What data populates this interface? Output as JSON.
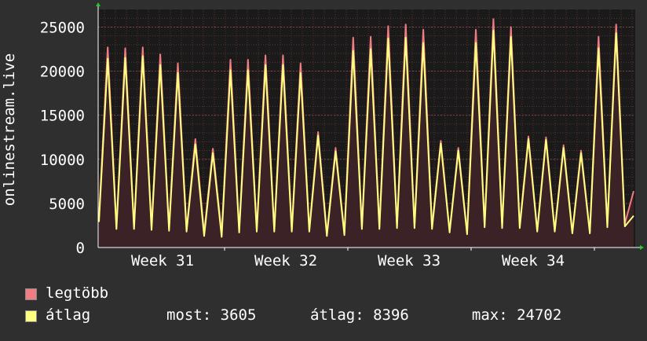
{
  "chart_data": {
    "type": "area",
    "ylabel": "onlinestream.live",
    "ylim": [
      0,
      27000
    ],
    "yticks": [
      0,
      5000,
      10000,
      15000,
      20000,
      25000
    ],
    "x_tick_labels": [
      "Week 31",
      "Week 32",
      "Week 33",
      "Week 34"
    ],
    "grid": true,
    "series": [
      {
        "name": "legtöbb",
        "color": "#f07d82",
        "values": [
          3400,
          22700,
          2400,
          22600,
          2400,
          22700,
          2300,
          21900,
          2200,
          20900,
          2100,
          12300,
          1700,
          11200,
          1600,
          21300,
          2000,
          21300,
          2100,
          21800,
          2100,
          21800,
          2100,
          20900,
          2100,
          13100,
          1600,
          11300,
          1700,
          23800,
          2400,
          23900,
          2400,
          25100,
          2500,
          25300,
          2500,
          24700,
          2400,
          12100,
          1900,
          11300,
          1700,
          24700,
          2600,
          25900,
          2500,
          25000,
          2500,
          12600,
          2000,
          12500,
          2000,
          11600,
          1800,
          11000,
          1800,
          23900,
          2600,
          25300,
          2700,
          6400
        ]
      },
      {
        "name": "átlag",
        "color": "#ffff80",
        "values": [
          2900,
          21400,
          2100,
          21500,
          2100,
          21700,
          2000,
          20700,
          1900,
          19800,
          1800,
          11700,
          1300,
          10700,
          1200,
          20100,
          1700,
          20100,
          1800,
          20700,
          1800,
          20700,
          1800,
          19800,
          1800,
          12700,
          1300,
          10900,
          1400,
          22300,
          2100,
          22500,
          2100,
          23700,
          2200,
          23800,
          2200,
          23200,
          2100,
          11800,
          1700,
          11000,
          1500,
          23200,
          2300,
          24600,
          2200,
          23900,
          2200,
          12300,
          1800,
          12200,
          1800,
          11300,
          1600,
          10700,
          1600,
          22600,
          2300,
          24300,
          2400,
          3600
        ]
      }
    ]
  },
  "legend": {
    "max_label": "legtöbb",
    "avg_label": "átlag",
    "stats": "most: 3605      átlag: 8396       max: 24702"
  }
}
